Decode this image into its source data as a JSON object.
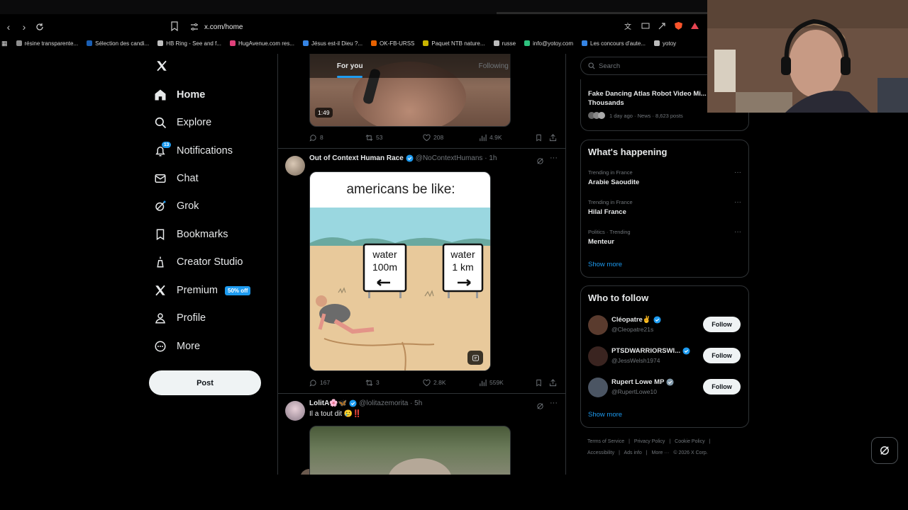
{
  "browser": {
    "url": "x.com/home",
    "bookmarks": [
      {
        "label": "résine transparente...",
        "color": "#8e8e8e"
      },
      {
        "label": "Sélection des candi...",
        "color": "#1a5fb4"
      },
      {
        "label": "HB Ring - See and f...",
        "color": "#c0c0c0"
      },
      {
        "label": "HugAvenue.com res...",
        "color": "#e0407a"
      },
      {
        "label": "Jésus est-il Dieu ?...",
        "color": "#3584e4"
      },
      {
        "label": "OK-FB-URSS",
        "color": "#e66100"
      },
      {
        "label": "Paquet NTB nature...",
        "color": "#c9b400"
      },
      {
        "label": "russe",
        "color": "#bbbbbb"
      },
      {
        "label": "info@yotoy.com",
        "color": "#2ec27e"
      },
      {
        "label": "Les concours d'aute...",
        "color": "#3584e4"
      },
      {
        "label": "yotoy",
        "color": "#bbbbbb"
      }
    ]
  },
  "nav": {
    "items": [
      {
        "label": "Home",
        "icon": "home-icon"
      },
      {
        "label": "Explore",
        "icon": "search-icon"
      },
      {
        "label": "Notifications",
        "icon": "bell-icon",
        "badge": "13"
      },
      {
        "label": "Chat",
        "icon": "mail-icon"
      },
      {
        "label": "Grok",
        "icon": "grok-icon"
      },
      {
        "label": "Bookmarks",
        "icon": "bookmark-icon"
      },
      {
        "label": "Creator Studio",
        "icon": "creator-icon"
      },
      {
        "label": "Premium",
        "icon": "x-logo-icon",
        "badge": "50% off"
      },
      {
        "label": "Profile",
        "icon": "person-icon"
      },
      {
        "label": "More",
        "icon": "more-circle-icon"
      }
    ],
    "post_label": "Post"
  },
  "timeline": {
    "tabs": [
      "For you",
      "Following"
    ],
    "video_duration": "1:49",
    "tweet0_stats": {
      "replies": "8",
      "reposts": "53",
      "likes": "208",
      "views": "4.9K"
    },
    "tweet1": {
      "name": "Out of Context Human Race",
      "handle": "@NoContextHumans · 1h",
      "image_text": {
        "headline": "americans be like:",
        "sign_left_1": "water",
        "sign_left_2": "100m",
        "sign_right_1": "water",
        "sign_right_2": "1 km"
      },
      "stats": {
        "replies": "167",
        "reposts": "3",
        "likes": "2.8K",
        "views": "559K"
      }
    },
    "tweet2": {
      "name": "LolitA🌸🦋",
      "handle": "@lolitazemorita · 5h",
      "text": "Il a tout dit 🥲‼️"
    }
  },
  "sidebar": {
    "search_placeholder": "Search",
    "top_news": {
      "title": "Fake Dancing Atlas Robot Video Mi... Thousands",
      "meta": "1 day ago · News · 8,623 posts"
    },
    "happening": {
      "title": "What's happening",
      "trends": [
        {
          "context": "Trending in France",
          "name": "Arabie Saoudite"
        },
        {
          "context": "Trending in France",
          "name": "Hilal France"
        },
        {
          "context": "Politics · Trending",
          "name": "Menteur"
        }
      ],
      "show_more": "Show more"
    },
    "who_to_follow": {
      "title": "Who to follow",
      "accounts": [
        {
          "name": "Cléopatre✌️",
          "handle": "@Cleopatre21s",
          "avatar_color": "#5a3b2e"
        },
        {
          "name": "PTSDWARRIORSWI...",
          "handle": "@JessWelsh1974",
          "avatar_color": "#3a2420"
        },
        {
          "name": "Rupert Lowe MP",
          "handle": "@RupertLowe10",
          "avatar_color": "#4b5563"
        }
      ],
      "follow_label": "Follow",
      "show_more": "Show more"
    },
    "footer_links": [
      "Terms of Service",
      "|",
      "Privacy Policy",
      "|",
      "Cookie Policy",
      "|",
      "Accessibility",
      "|",
      "Ads info",
      "|",
      "More ···",
      "© 2026 X Corp."
    ]
  },
  "colors": {
    "accent": "#1d9bf0",
    "background": "#000000",
    "border": "#2f3336",
    "muted": "#71767b"
  }
}
